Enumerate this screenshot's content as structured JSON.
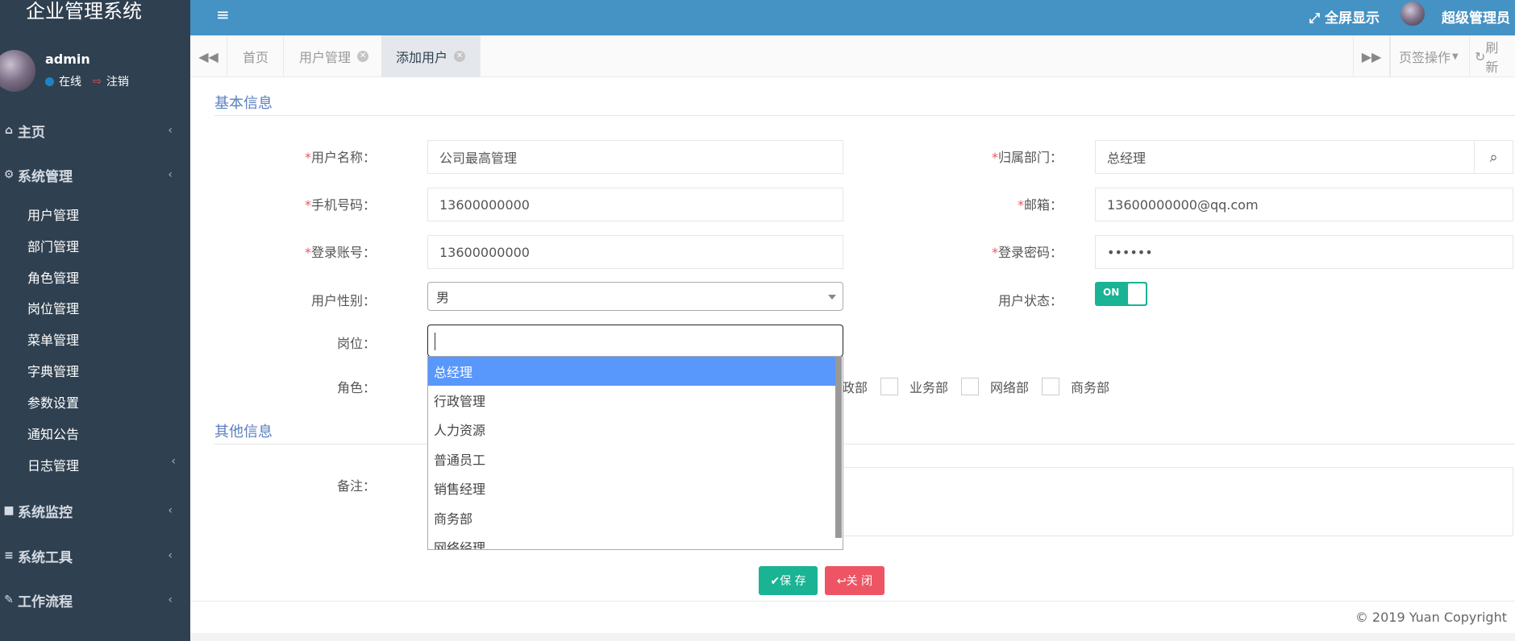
{
  "app": {
    "title": "企业管理系统"
  },
  "profile": {
    "name": "admin",
    "status": "在线",
    "logout": "注销"
  },
  "sidebar": {
    "home": "主页",
    "system": "系统管理",
    "sub_items": [
      "用户管理",
      "部门管理",
      "角色管理",
      "岗位管理",
      "菜单管理",
      "字典管理",
      "参数设置",
      "通知公告",
      "日志管理"
    ],
    "monitor": "系统监控",
    "tools": "系统工具",
    "workflow": "工作流程"
  },
  "header": {
    "fullscreen": "全屏显示",
    "user": "超级管理员"
  },
  "tabs": {
    "home": "首页",
    "user_mgmt": "用户管理",
    "add_user": "添加用户",
    "page_ops": "页签操作",
    "refresh": "刷新"
  },
  "form": {
    "section_basic": "基本信息",
    "section_other": "其他信息",
    "username_label": "用户名称：",
    "username_value": "公司最高管理",
    "dept_label": "归属部门：",
    "dept_value": "总经理",
    "phone_label": "手机号码：",
    "phone_value": "13600000000",
    "email_label": "邮箱：",
    "email_value": "13600000000@qq.com",
    "login_label": "登录账号：",
    "login_value": "13600000000",
    "password_label": "登录密码：",
    "password_value": "••••••",
    "gender_label": "用户性别：",
    "gender_value": "男",
    "status_label": "用户状态：",
    "status_value": "ON",
    "post_label": "岗位：",
    "role_label": "角色：",
    "roles_visible": [
      "政部",
      "业务部",
      "网络部",
      "商务部"
    ],
    "remark_label": "备注："
  },
  "post_dropdown": [
    "总经理",
    "行政管理",
    "人力资源",
    "普通员工",
    "销售经理",
    "商务部",
    "网络经理"
  ],
  "buttons": {
    "save": "✔保 存",
    "close": "↩关 闭"
  },
  "footer": {
    "copyright": "© 2019 Yuan Copyright"
  }
}
